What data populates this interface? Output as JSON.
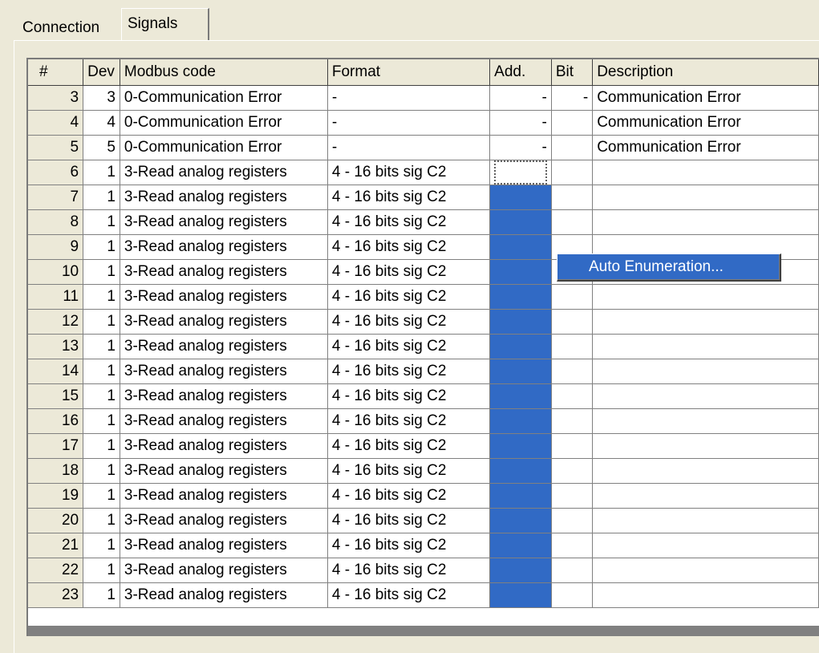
{
  "tabs": [
    {
      "label": "Connection",
      "active": false
    },
    {
      "label": "Signals",
      "active": true
    }
  ],
  "grid": {
    "columns": [
      "#",
      "Dev",
      "Modbus code",
      "Format",
      "Add.",
      "Bit",
      "Description"
    ],
    "rows": [
      {
        "num": "3",
        "dev": "3",
        "code": "0-Communication Error",
        "format": "-",
        "add": "-",
        "bit": "-",
        "desc": "Communication Error"
      },
      {
        "num": "4",
        "dev": "4",
        "code": "0-Communication Error",
        "format": "-",
        "add": "-",
        "bit": "",
        "desc": "Communication Error"
      },
      {
        "num": "5",
        "dev": "5",
        "code": "0-Communication Error",
        "format": "-",
        "add": "-",
        "bit": "",
        "desc": "Communication Error"
      },
      {
        "num": "6",
        "dev": "1",
        "code": "3-Read analog registers",
        "format": "4 - 16 bits sig C2",
        "add": "",
        "bit": "",
        "desc": ""
      },
      {
        "num": "7",
        "dev": "1",
        "code": "3-Read analog registers",
        "format": "4 - 16 bits sig C2",
        "add": "",
        "bit": "",
        "desc": ""
      },
      {
        "num": "8",
        "dev": "1",
        "code": "3-Read analog registers",
        "format": "4 - 16 bits sig C2",
        "add": "",
        "bit": "",
        "desc": ""
      },
      {
        "num": "9",
        "dev": "1",
        "code": "3-Read analog registers",
        "format": "4 - 16 bits sig C2",
        "add": "",
        "bit": "",
        "desc": ""
      },
      {
        "num": "10",
        "dev": "1",
        "code": "3-Read analog registers",
        "format": "4 - 16 bits sig C2",
        "add": "",
        "bit": "",
        "desc": ""
      },
      {
        "num": "11",
        "dev": "1",
        "code": "3-Read analog registers",
        "format": "4 - 16 bits sig C2",
        "add": "",
        "bit": "",
        "desc": ""
      },
      {
        "num": "12",
        "dev": "1",
        "code": "3-Read analog registers",
        "format": "4 - 16 bits sig C2",
        "add": "",
        "bit": "",
        "desc": ""
      },
      {
        "num": "13",
        "dev": "1",
        "code": "3-Read analog registers",
        "format": "4 - 16 bits sig C2",
        "add": "",
        "bit": "",
        "desc": ""
      },
      {
        "num": "14",
        "dev": "1",
        "code": "3-Read analog registers",
        "format": "4 - 16 bits sig C2",
        "add": "",
        "bit": "",
        "desc": ""
      },
      {
        "num": "15",
        "dev": "1",
        "code": "3-Read analog registers",
        "format": "4 - 16 bits sig C2",
        "add": "",
        "bit": "",
        "desc": ""
      },
      {
        "num": "16",
        "dev": "1",
        "code": "3-Read analog registers",
        "format": "4 - 16 bits sig C2",
        "add": "",
        "bit": "",
        "desc": ""
      },
      {
        "num": "17",
        "dev": "1",
        "code": "3-Read analog registers",
        "format": "4 - 16 bits sig C2",
        "add": "",
        "bit": "",
        "desc": ""
      },
      {
        "num": "18",
        "dev": "1",
        "code": "3-Read analog registers",
        "format": "4 - 16 bits sig C2",
        "add": "",
        "bit": "",
        "desc": ""
      },
      {
        "num": "19",
        "dev": "1",
        "code": "3-Read analog registers",
        "format": "4 - 16 bits sig C2",
        "add": "",
        "bit": "",
        "desc": ""
      },
      {
        "num": "20",
        "dev": "1",
        "code": "3-Read analog registers",
        "format": "4 - 16 bits sig C2",
        "add": "",
        "bit": "",
        "desc": ""
      },
      {
        "num": "21",
        "dev": "1",
        "code": "3-Read analog registers",
        "format": "4 - 16 bits sig C2",
        "add": "",
        "bit": "",
        "desc": ""
      },
      {
        "num": "22",
        "dev": "1",
        "code": "3-Read analog registers",
        "format": "4 - 16 bits sig C2",
        "add": "",
        "bit": "",
        "desc": ""
      },
      {
        "num": "23",
        "dev": "1",
        "code": "3-Read analog registers",
        "format": "4 - 16 bits sig C2",
        "add": "",
        "bit": "",
        "desc": ""
      }
    ],
    "focused_row": "6",
    "selected_rows": [
      "7",
      "8",
      "9",
      "10",
      "11",
      "12",
      "13",
      "14",
      "15",
      "16",
      "17",
      "18",
      "19",
      "20",
      "21",
      "22",
      "23"
    ]
  },
  "context_menu": {
    "items": [
      {
        "label": "Auto Enumeration..."
      }
    ]
  },
  "colors": {
    "window_bg": "#ece9d8",
    "selection": "#316ac5",
    "grid_bg": "#ffffff"
  }
}
